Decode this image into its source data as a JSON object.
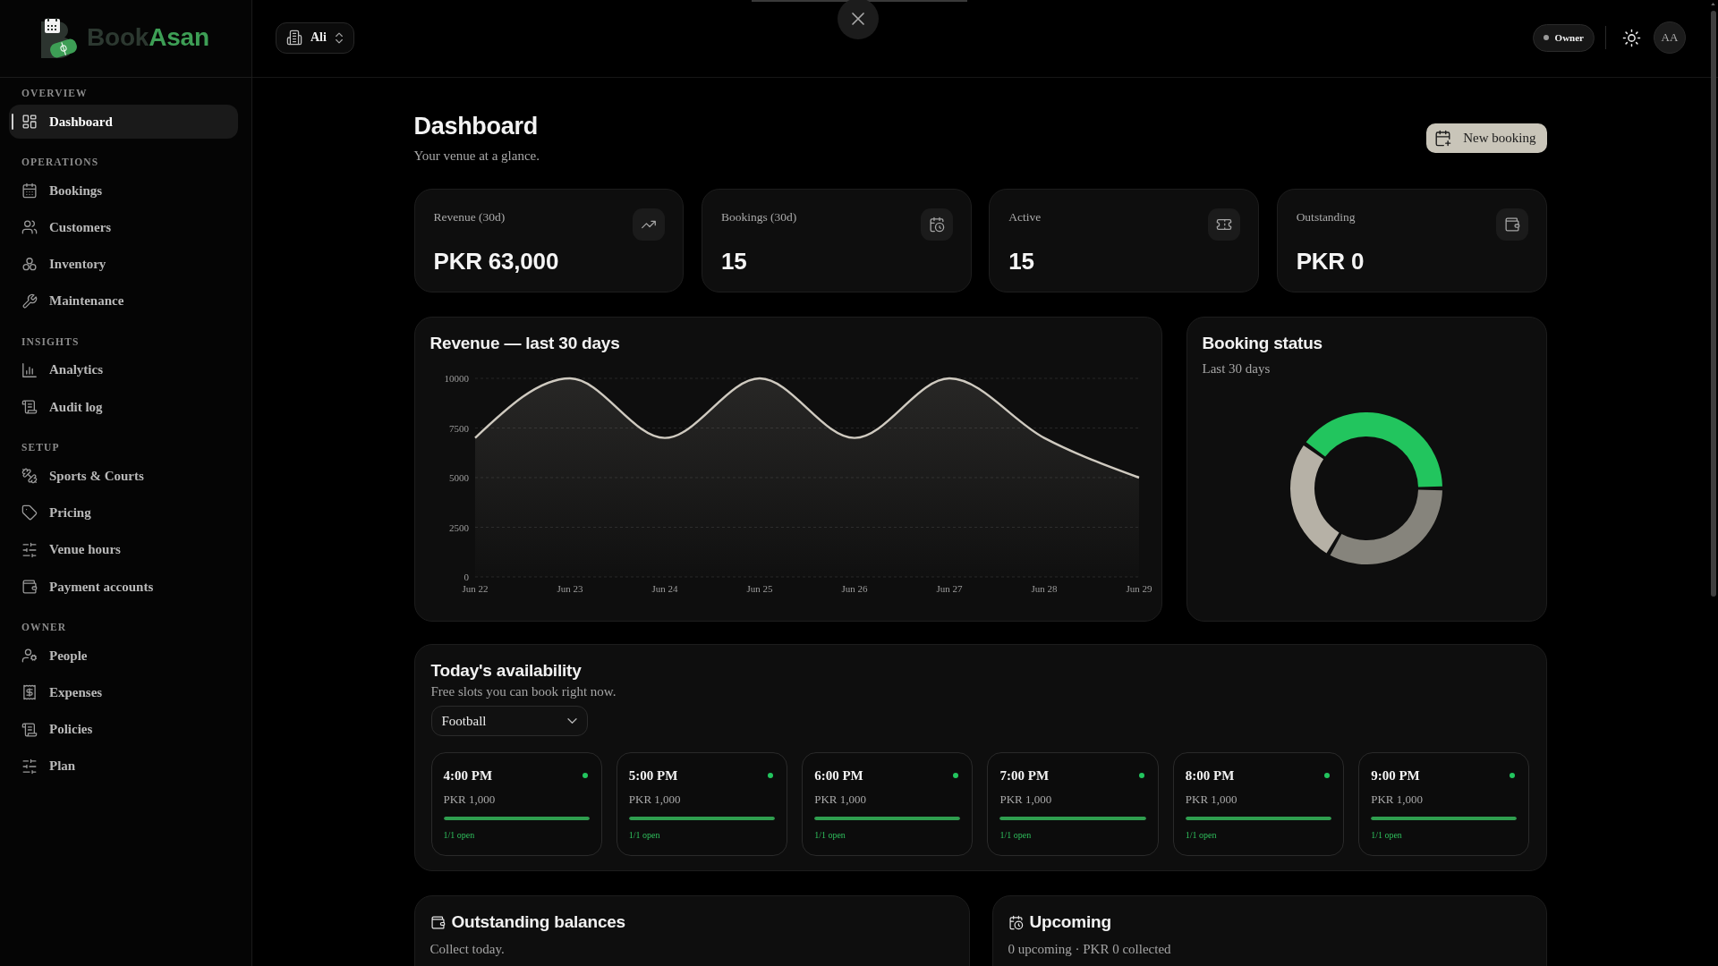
{
  "brand": {
    "name_start": "Book",
    "name_end": "Asan"
  },
  "sidebar": {
    "sections": [
      {
        "heading": "OVERVIEW",
        "items": [
          {
            "label": "Dashboard",
            "selected": true
          }
        ]
      },
      {
        "heading": "OPERATIONS",
        "items": [
          {
            "label": "Bookings",
            "selected": false
          },
          {
            "label": "Customers",
            "selected": false
          },
          {
            "label": "Inventory",
            "selected": false
          },
          {
            "label": "Maintenance",
            "selected": false
          }
        ]
      },
      {
        "heading": "INSIGHTS",
        "items": [
          {
            "label": "Analytics",
            "selected": false
          },
          {
            "label": "Audit log",
            "selected": false
          }
        ]
      },
      {
        "heading": "SETUP",
        "items": [
          {
            "label": "Sports & Courts",
            "selected": false
          },
          {
            "label": "Pricing",
            "selected": false
          },
          {
            "label": "Venue hours",
            "selected": false
          },
          {
            "label": "Payment accounts",
            "selected": false
          }
        ]
      },
      {
        "heading": "OWNER",
        "items": [
          {
            "label": "People",
            "selected": false
          },
          {
            "label": "Expenses",
            "selected": false
          },
          {
            "label": "Policies",
            "selected": false
          },
          {
            "label": "Plan",
            "selected": false
          }
        ]
      }
    ]
  },
  "topbar": {
    "venue_selector": {
      "value": "Ali"
    },
    "role_badge": "Owner",
    "avatar_initials": "AA"
  },
  "page": {
    "title": "Dashboard",
    "subtitle": "Your venue at a glance.",
    "new_booking_button": "New booking"
  },
  "stats": [
    {
      "label": "Revenue (30d)",
      "value": "PKR 63,000"
    },
    {
      "label": "Bookings (30d)",
      "value": "15"
    },
    {
      "label": "Active",
      "value": "15"
    },
    {
      "label": "Outstanding",
      "value": "PKR 0"
    }
  ],
  "revenue_card": {
    "chart_data": {
      "type": "area",
      "title": "Revenue — last 30 days",
      "categories": [
        "Jun 22",
        "Jun 23",
        "Jun 24",
        "Jun 25",
        "Jun 26",
        "Jun 27",
        "Jun 28",
        "Jun 29"
      ],
      "values": [
        7000,
        10000,
        7000,
        10000,
        7000,
        10000,
        7000,
        5000
      ],
      "ylim": [
        0,
        10000
      ],
      "yticks": [
        0,
        2500,
        5000,
        7500,
        10000
      ],
      "grid": true
    }
  },
  "booking_status": {
    "title": "Booking status",
    "subtitle": "Last 30 days"
  },
  "availability": {
    "title": "Today's availability",
    "subtitle": "Free slots you can book right now.",
    "sport_select": {
      "value": "Football"
    },
    "slots": [
      {
        "time": "4:00 PM",
        "price": "PKR 1,000",
        "level": 1,
        "availability": "1/1 open"
      },
      {
        "time": "5:00 PM",
        "price": "PKR 1,000",
        "level": 1,
        "availability": "1/1 open"
      },
      {
        "time": "6:00 PM",
        "price": "PKR 1,000",
        "level": 1,
        "availability": "1/1 open"
      },
      {
        "time": "7:00 PM",
        "price": "PKR 1,000",
        "level": 1,
        "availability": "1/1 open"
      },
      {
        "time": "8:00 PM",
        "price": "PKR 1,000",
        "level": 1,
        "availability": "1/1 open"
      },
      {
        "time": "9:00 PM",
        "price": "PKR 1,000",
        "level": 1,
        "availability": "1/1 open"
      }
    ]
  },
  "outstanding_balances": {
    "title": "Outstanding balances",
    "subtitle": "Collect today."
  },
  "upcoming": {
    "title": "Upcoming",
    "subtitle": "0 upcoming · PKR 0 collected"
  }
}
